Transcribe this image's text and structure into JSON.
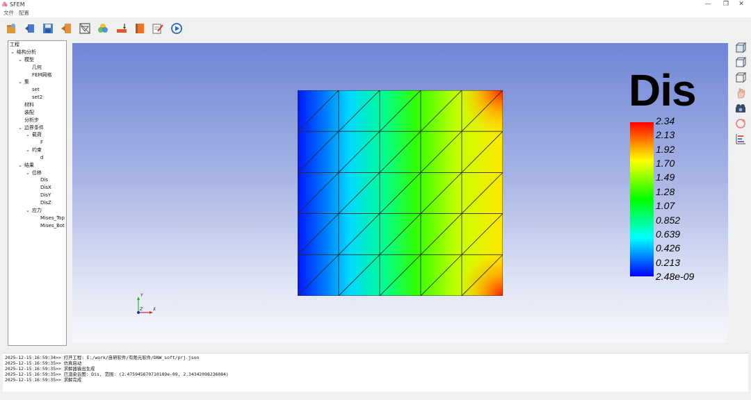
{
  "window": {
    "title": "SFEM",
    "controls": [
      "—",
      "❐",
      "✕"
    ]
  },
  "menu": [
    "文件",
    "配置"
  ],
  "toolbar": [
    {
      "name": "new-project-icon"
    },
    {
      "name": "import-geometry-icon"
    },
    {
      "name": "save-icon"
    },
    {
      "name": "export-icon"
    },
    {
      "name": "mesh-icon"
    },
    {
      "name": "material-icon"
    },
    {
      "name": "boundary-condition-icon"
    },
    {
      "name": "book-icon"
    },
    {
      "name": "edit-icon"
    },
    {
      "name": "run-icon"
    }
  ],
  "tree": {
    "root": "工程",
    "items": [
      {
        "label": "结构分析",
        "level": 1,
        "expanded": true
      },
      {
        "label": "模型",
        "level": 2,
        "expanded": true
      },
      {
        "label": "几何",
        "level": 3
      },
      {
        "label": "FEM网格",
        "level": 3
      },
      {
        "label": "集",
        "level": 2,
        "expanded": true
      },
      {
        "label": "set",
        "level": 3
      },
      {
        "label": "set2",
        "level": 3
      },
      {
        "label": "材料",
        "level": 2
      },
      {
        "label": "装配",
        "level": 2
      },
      {
        "label": "分析步",
        "level": 2
      },
      {
        "label": "边界条件",
        "level": 2,
        "expanded": true
      },
      {
        "label": "载荷",
        "level": 3,
        "expanded": true
      },
      {
        "label": "F",
        "level": 4
      },
      {
        "label": "约束",
        "level": 3,
        "expanded": true
      },
      {
        "label": "d",
        "level": 4
      },
      {
        "label": "结果",
        "level": 2,
        "expanded": true
      },
      {
        "label": "位移",
        "level": 3,
        "expanded": true
      },
      {
        "label": "Dis",
        "level": 4
      },
      {
        "label": "DisX",
        "level": 4
      },
      {
        "label": "DisY",
        "level": 4
      },
      {
        "label": "DisZ",
        "level": 4
      },
      {
        "label": "应力",
        "level": 3,
        "expanded": true
      },
      {
        "label": "Mises_Top",
        "level": 4
      },
      {
        "label": "Mises_Bot",
        "level": 4
      }
    ]
  },
  "viewport": {
    "legend_title": "Dis",
    "legend_labels": [
      "2.34",
      "2.13",
      "1.92",
      "1.70",
      "1.49",
      "1.28",
      "1.07",
      "0.852",
      "0.639",
      "0.426",
      "0.213",
      "2.48e-09"
    ],
    "axes": {
      "y": "Y",
      "z": "Z",
      "x": "X"
    },
    "mesh_grid": {
      "rows": 5,
      "cols": 5
    },
    "colors": {
      "min": "#0000ff",
      "max": "#ff0000"
    }
  },
  "right_toolbar": [
    {
      "name": "view-front-icon"
    },
    {
      "name": "view-iso-icon"
    },
    {
      "name": "view-wireframe-icon"
    },
    {
      "name": "pan-hand-icon"
    },
    {
      "name": "camera-icon"
    },
    {
      "name": "rotate-icon"
    },
    {
      "name": "chart-icon"
    }
  ],
  "console": [
    "2025-12-15 16:59:34>> 打开工程: E:/work/自研软件/有限元软件/DNW_soft/prj.json",
    "2025-12-15 16:59:35>> 仿真启动",
    "2025-12-15 16:59:35>> 求解器输出生成",
    "2025-12-15 16:59:35>> 已渲染云图: Dis, 范围: (2.475945670710189e-09, 2.34342098236084)",
    "2025-12-15 16:59:35>> 求解完成"
  ]
}
